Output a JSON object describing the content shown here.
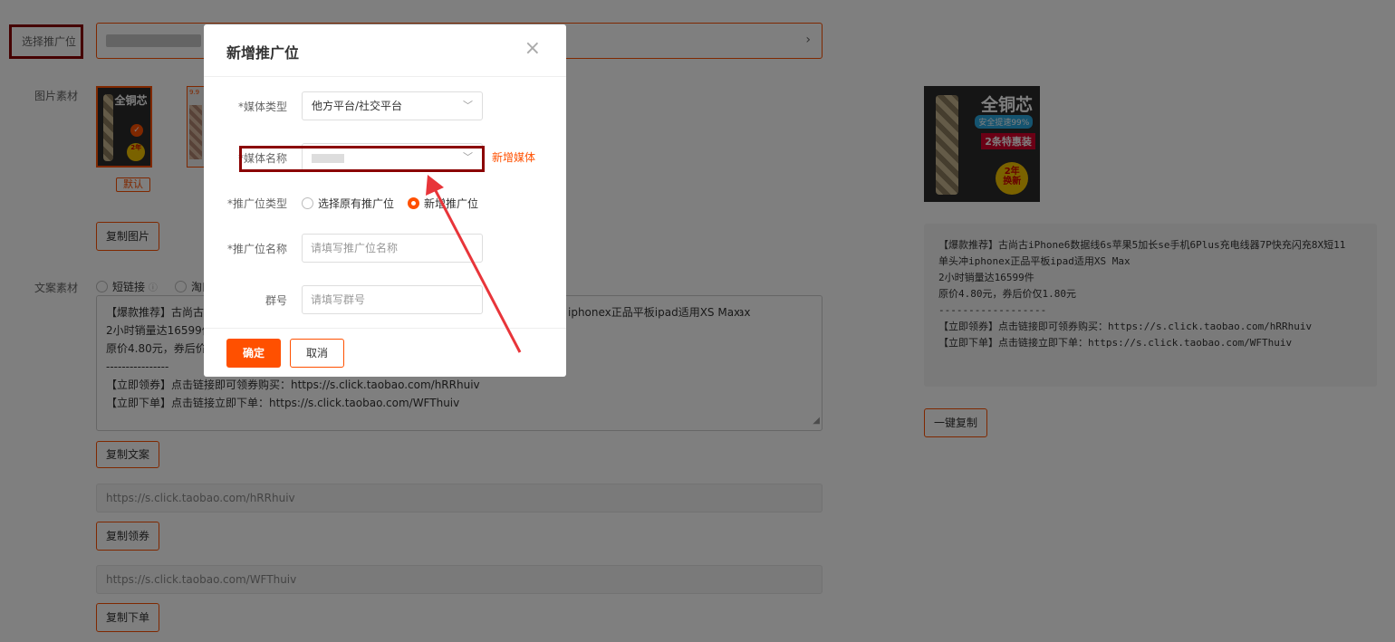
{
  "left": {
    "label_select_position": "选择推广位",
    "selector_partial": "2",
    "label_image": "图片素材",
    "thumb_badge": "9.9",
    "default_tag": "默认",
    "btn_copy_image": "复制图片",
    "label_copy": "文案素材",
    "radio_short_link": "短链接",
    "radio_taobao": "淘口令",
    "textarea_lines": [
      "【爆款推荐】古尚古iPhone6数据线6s苹果5加长se手机6Plus充电线器7P快充闪充8X短11单头冲iphonex正品平板ipad适用XS Max",
      "2小时销量达16599件",
      "原价4.80元，券后价仅1.80元",
      "----------------",
      "【立即领券】点击链接即可领券购买：https://s.click.taobao.com/hRRhuiv",
      "【立即下单】点击链接立即下单：https://s.click.taobao.com/WFThuiv"
    ],
    "textarea_visible_line0_tail": "iphonex正品平板ipad适用XS Max",
    "btn_copy_text": "复制文案",
    "coupon_link": "https://s.click.taobao.com/hRRhuiv",
    "btn_copy_coupon": "复制领券",
    "order_link": "https://s.click.taobao.com/WFThuiv",
    "btn_copy_order": "复制下单"
  },
  "product_image": {
    "headline": "全铜芯",
    "subline": "安全提速99%",
    "promo": "2条特惠装",
    "badge_line1": "2年",
    "badge_line2": "换新"
  },
  "right": {
    "preview_lines": [
      "【爆款推荐】古尚古iPhone6数据线6s苹果5加长se手机6Plus充电线器7P快充闪充8X短11",
      "单头冲iphonex正品平板ipad适用XS Max",
      "2小时销量达16599件",
      "原价4.80元，券后价仅1.80元",
      "------------------",
      "【立即领券】点击链接即可领券购买：https://s.click.taobao.com/hRRhuiv",
      "【立即下单】点击链接立即下单：https://s.click.taobao.com/WFThuiv"
    ],
    "btn_copy_all": "一键复制"
  },
  "modal": {
    "title": "新增推广位",
    "close_glyph": "×",
    "label_media_type": "*媒体类型",
    "media_type_value": "他方平台/社交平台",
    "label_media_name": "*媒体名称",
    "add_media_link": "新增媒体",
    "label_position_type": "*推广位类型",
    "radio_existing": "选择原有推广位",
    "radio_new": "新增推广位",
    "label_position_name": "*推广位名称",
    "position_name_placeholder": "请填写推广位名称",
    "label_group": "群号",
    "group_placeholder": "请填写群号",
    "btn_confirm": "确定",
    "btn_cancel": "取消"
  },
  "colors": {
    "accent": "#ff5000",
    "highlight": "#8b0000",
    "arrow": "#e8353a"
  }
}
